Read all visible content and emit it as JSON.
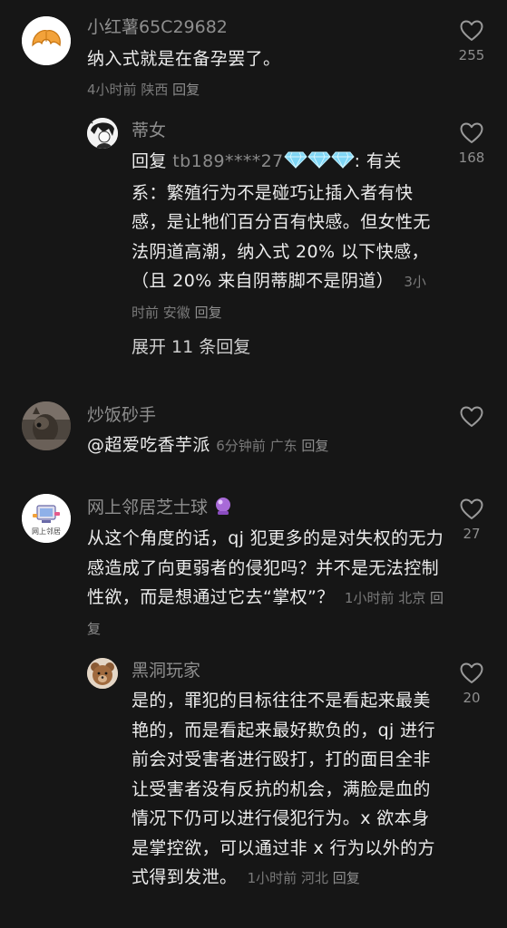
{
  "comments": [
    {
      "username": "小红薯65C29682",
      "text": "纳入式就是在备孕罢了。",
      "time": "4小时前",
      "location": "陕西",
      "reply_label": "回复",
      "likes": "255",
      "avatar_icon": "croissant-icon",
      "replies": [
        {
          "username": "蒂女",
          "reply_prefix": "回复",
          "mention": "tb189****27",
          "text_after_mention": ": 有关系：繁殖行为不是碰巧让插入者有快感，是让牠们百分百有快感。但女性无法阴道高潮，纳入式 20% 以下快感，（且 20% 来自阴蒂脚不是阴道）",
          "time": "3小时前",
          "location": "安徽",
          "reply_label": "回复",
          "likes": "168",
          "avatar_icon": "anime-avatar-icon",
          "gem_icon": "diamond-icon"
        }
      ],
      "expand_label": "展开 11 条回复"
    },
    {
      "username": "炒饭砂手",
      "text": "@超爱吃香芋派",
      "time": "6分钟前",
      "location": "广东",
      "reply_label": "回复",
      "likes": "",
      "avatar_icon": "alpaca-photo-icon"
    },
    {
      "username": "网上邻居芝士球",
      "username_emoji": "crystal-ball-icon",
      "text": "从这个角度的话，qj 犯更多的是对失权的无力感造成了向更弱者的侵犯吗？并不是无法控制性欲，而是想通过它去“掌权”？",
      "time": "1小时前",
      "location": "北京",
      "reply_label": "回复",
      "likes": "27",
      "avatar_icon": "computer-avatar-icon",
      "avatar_caption": "网上邻居",
      "replies": [
        {
          "username": "黑洞玩家",
          "text": "是的，罪犯的目标往往不是看起来最美艳的，而是看起来最好欺负的，qj 进行前会对受害者进行殴打，打的面目全非让受害者没有反抗的机会，满脸是血的情况下仍可以进行侵犯行为。x 欲本身是掌控欲，可以通过非 x 行为以外的方式得到发泄。",
          "time": "1小时前",
          "location": "河北",
          "reply_label": "回复",
          "likes": "20",
          "avatar_icon": "teddy-bear-icon"
        }
      ]
    }
  ],
  "colors": {
    "background": "#161616",
    "text": "#ececec",
    "muted": "#8e8e8e",
    "diamond": "#7fd6f5"
  }
}
